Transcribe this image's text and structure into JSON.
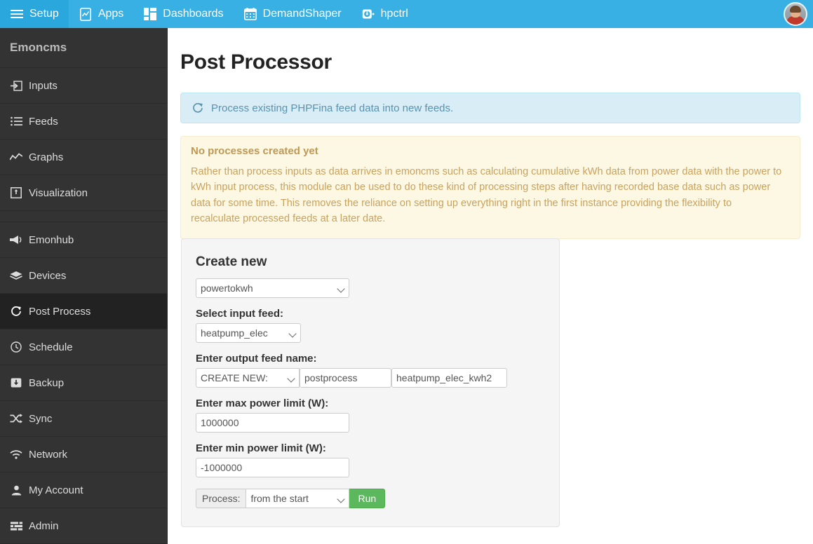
{
  "navbar": {
    "items": [
      {
        "label": "Setup",
        "icon": "hamburger-icon",
        "active": true
      },
      {
        "label": "Apps",
        "icon": "apps-icon",
        "active": false
      },
      {
        "label": "Dashboards",
        "icon": "dashboards-icon",
        "active": false
      },
      {
        "label": "DemandShaper",
        "icon": "calendar-icon",
        "active": false
      },
      {
        "label": "hpctrl",
        "icon": "gauge-icon",
        "active": false
      }
    ],
    "avatar": "user-avatar",
    "background_color": "#38b0e3",
    "active_color": "#2aa8dd"
  },
  "sidebar": {
    "title": "Emoncms",
    "background_color": "#333333",
    "active_color": "#222222",
    "items": [
      {
        "label": "Inputs",
        "icon": "input-arrow-icon",
        "active": false
      },
      {
        "label": "Feeds",
        "icon": "list-icon",
        "active": false
      },
      {
        "label": "Graphs",
        "icon": "line-chart-icon",
        "active": false
      },
      {
        "label": "Visualization",
        "icon": "visualization-icon",
        "active": false
      },
      {
        "label": "Emonhub",
        "icon": "megaphone-icon",
        "active": false,
        "group_start": true
      },
      {
        "label": "Devices",
        "icon": "layers-icon",
        "active": false
      },
      {
        "label": "Post Process",
        "icon": "refresh-icon",
        "active": true
      },
      {
        "label": "Schedule",
        "icon": "clock-icon",
        "active": false
      },
      {
        "label": "Backup",
        "icon": "download-box-icon",
        "active": false
      },
      {
        "label": "Sync",
        "icon": "shuffle-icon",
        "active": false
      },
      {
        "label": "Network",
        "icon": "wifi-icon",
        "active": false
      },
      {
        "label": "My Account",
        "icon": "user-icon",
        "active": false
      },
      {
        "label": "Admin",
        "icon": "sliders-icon",
        "active": false
      }
    ]
  },
  "main": {
    "page_title": "Post Processor",
    "info_alert": {
      "icon": "refresh-icon",
      "text": "Process existing PHPFina feed data into new feeds.",
      "background_color": "#d9edf7",
      "text_color": "#5b93ad"
    },
    "warning_alert": {
      "heading": "No processes created yet",
      "body": "Rather than process inputs as data arrives in emoncms such as calculating cumulative kWh data from power data with the power to kWh input process, this module can be used to do these kind of processing steps after having recorded base data such as power data for some time. This removes the reliance on setting up everything right in the first instance providing the flexibility to recalculate processed feeds at a later date.",
      "background_color": "#fcf8e3",
      "text_color": "#c09853"
    },
    "create_panel": {
      "heading": "Create new",
      "process_select": {
        "value": "powertokwh",
        "options": [
          "powertokwh"
        ]
      },
      "input_feed_label": "Select input feed:",
      "input_feed_select": {
        "value": "heatpump_elec",
        "options": [
          "heatpump_elec"
        ]
      },
      "output_feed_label": "Enter output feed name:",
      "output_mode_select": {
        "value": "CREATE NEW:",
        "options": [
          "CREATE NEW:"
        ]
      },
      "output_prefix": {
        "value": "postprocess",
        "placeholder": "prefix"
      },
      "output_name": {
        "value": "heatpump_elec_kwh2",
        "placeholder": "feed name"
      },
      "max_power_label": "Enter max power limit (W):",
      "max_power": {
        "value": "1000000",
        "placeholder": "max"
      },
      "min_power_label": "Enter min power limit (W):",
      "min_power": {
        "value": "-1000000",
        "placeholder": "min"
      },
      "process_addon_label": "Process:",
      "process_range_select": {
        "value": "from the start",
        "options": [
          "from the start"
        ]
      },
      "run_button": "Run",
      "run_button_color": "#5cb85c"
    }
  }
}
